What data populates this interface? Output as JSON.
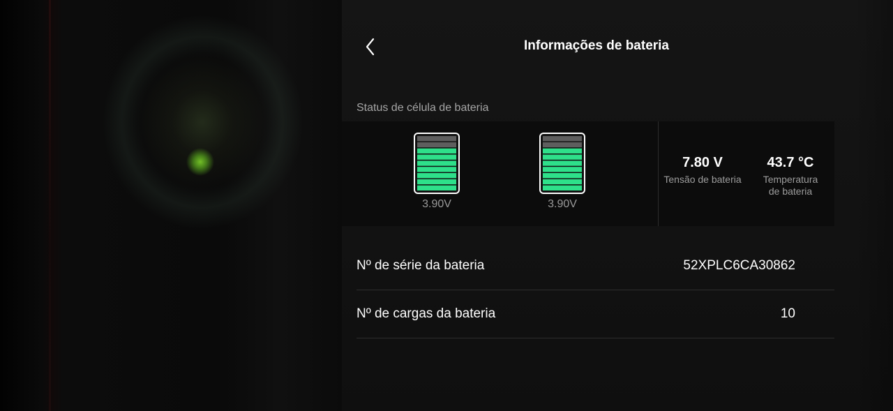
{
  "header": {
    "title": "Informações de bateria",
    "back_icon": "chevron-left-icon"
  },
  "cell_status": {
    "label": "Status de célula de bateria",
    "cells": [
      {
        "voltage": "3.90V",
        "charge_bars_filled": 7,
        "charge_bars_total": 9
      },
      {
        "voltage": "3.90V",
        "charge_bars_filled": 7,
        "charge_bars_total": 9
      }
    ],
    "metrics": {
      "voltage_value": "7.80 V",
      "voltage_label": "Tensão de bateria",
      "temperature_value": "43.7 °C",
      "temperature_label_line1": "Temperatura",
      "temperature_label_line2": "de bateria"
    }
  },
  "details": {
    "serial_label": "Nº de série da bateria",
    "serial_value": "52XPLC6CA30862",
    "cycles_label": "Nº de cargas da bateria",
    "cycles_value": "10"
  },
  "colors": {
    "cell_fill": "#2ee08a",
    "cell_empty": "#5e5e5e",
    "cell_border": "#ffffff",
    "panel_bg": "#141414",
    "text_primary": "#ffffff",
    "text_secondary": "#a6a6a6"
  }
}
